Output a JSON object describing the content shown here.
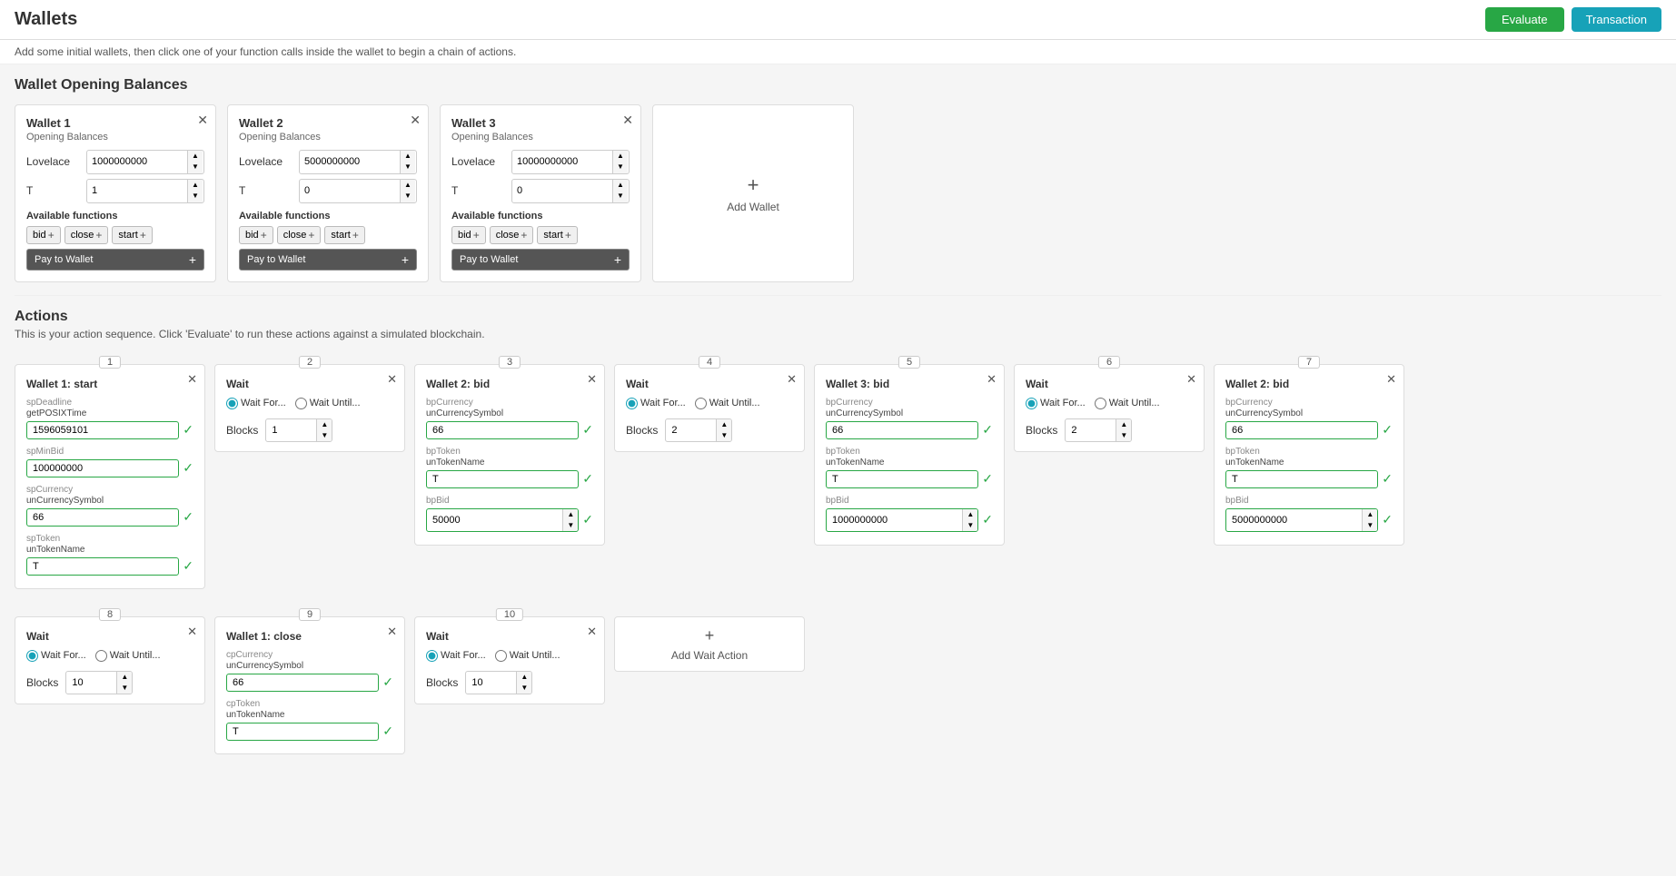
{
  "app": {
    "title": "Wallets",
    "subtitle": "Add some initial wallets, then click one of your function calls inside the wallet to begin a chain of actions.",
    "evaluate_label": "Evaluate",
    "transaction_label": "Transaction"
  },
  "wallets_section": {
    "title": "Wallet Opening Balances",
    "wallets": [
      {
        "id": 1,
        "title": "Wallet 1",
        "opening_balances_label": "Opening Balances",
        "lovelace_label": "Lovelace",
        "lovelace_value": "1000000000",
        "t_label": "T",
        "t_value": "1",
        "available_functions_label": "Available functions",
        "functions": [
          "bid",
          "close",
          "start"
        ],
        "pay_to_wallet_label": "Pay to Wallet"
      },
      {
        "id": 2,
        "title": "Wallet 2",
        "opening_balances_label": "Opening Balances",
        "lovelace_label": "Lovelace",
        "lovelace_value": "5000000000",
        "t_label": "T",
        "t_value": "0",
        "available_functions_label": "Available functions",
        "functions": [
          "bid",
          "close",
          "start"
        ],
        "pay_to_wallet_label": "Pay to Wallet"
      },
      {
        "id": 3,
        "title": "Wallet 3",
        "opening_balances_label": "Opening Balances",
        "lovelace_label": "Lovelace",
        "lovelace_value": "10000000000",
        "t_label": "T",
        "t_value": "0",
        "available_functions_label": "Available functions",
        "functions": [
          "bid",
          "close",
          "start"
        ],
        "pay_to_wallet_label": "Pay to Wallet"
      }
    ],
    "add_wallet_label": "Add Wallet"
  },
  "actions_section": {
    "title": "Actions",
    "subtitle": "This is your action sequence. Click 'Evaluate' to run these actions against a simulated blockchain.",
    "add_wait_label": "Add Wait Action",
    "actions": [
      {
        "num": "1",
        "type": "wallet_start",
        "title": "Wallet 1: start",
        "fields": [
          {
            "label": "spDeadline",
            "sublabel": "getPOSIXTime",
            "value": "1596059101",
            "valid": true
          },
          {
            "label": "spMinBid",
            "sublabel": "",
            "value": "100000000",
            "valid": true
          },
          {
            "label": "spCurrency",
            "sublabel": "unCurrencySymbol",
            "value": "66",
            "valid": true
          },
          {
            "label": "spToken",
            "sublabel": "unTokenName",
            "value": "T",
            "valid": true
          }
        ]
      },
      {
        "num": "2",
        "type": "wait",
        "title": "Wait",
        "wait_for_checked": true,
        "wait_until_checked": false,
        "wait_for_label": "Wait For...",
        "wait_until_label": "Wait Until...",
        "blocks_label": "Blocks",
        "blocks_value": "1"
      },
      {
        "num": "3",
        "type": "wallet_bid",
        "title": "Wallet 2: bid",
        "fields": [
          {
            "label": "bpCurrency",
            "sublabel": "unCurrencySymbol",
            "value": "66",
            "valid": true
          },
          {
            "label": "bpToken",
            "sublabel": "unTokenName",
            "value": "T",
            "valid": true
          },
          {
            "label": "bpBid",
            "sublabel": "",
            "value": "50000",
            "valid": true,
            "spinner": true
          }
        ]
      },
      {
        "num": "4",
        "type": "wait",
        "title": "Wait",
        "wait_for_checked": true,
        "wait_until_checked": false,
        "wait_for_label": "Wait For...",
        "wait_until_label": "Wait Until...",
        "blocks_label": "Blocks",
        "blocks_value": "2"
      },
      {
        "num": "5",
        "type": "wallet_bid",
        "title": "Wallet 3: bid",
        "fields": [
          {
            "label": "bpCurrency",
            "sublabel": "unCurrencySymbol",
            "value": "66",
            "valid": true
          },
          {
            "label": "bpToken",
            "sublabel": "unTokenName",
            "value": "T",
            "valid": true
          },
          {
            "label": "bpBid",
            "sublabel": "",
            "value": "1000000000",
            "valid": true,
            "spinner": true
          }
        ]
      },
      {
        "num": "6",
        "type": "wait",
        "title": "Wait",
        "wait_for_checked": true,
        "wait_until_checked": false,
        "wait_for_label": "Wait For...",
        "wait_until_label": "Wait Until...",
        "blocks_label": "Blocks",
        "blocks_value": "2"
      },
      {
        "num": "7",
        "type": "wallet_bid",
        "title": "Wallet 2: bid",
        "fields": [
          {
            "label": "bpCurrency",
            "sublabel": "unCurrencySymbol",
            "value": "66",
            "valid": true
          },
          {
            "label": "bpToken",
            "sublabel": "unTokenName",
            "value": "T",
            "valid": true
          },
          {
            "label": "bpBid",
            "sublabel": "",
            "value": "5000000000",
            "valid": true,
            "spinner": true
          }
        ]
      },
      {
        "num": "8",
        "type": "wait",
        "title": "Wait",
        "wait_for_checked": true,
        "wait_until_checked": false,
        "wait_for_label": "Wait For...",
        "wait_until_label": "Wait Until...",
        "blocks_label": "Blocks",
        "blocks_value": "10"
      },
      {
        "num": "9",
        "type": "wallet_close",
        "title": "Wallet 1: close",
        "fields": [
          {
            "label": "cpCurrency",
            "sublabel": "unCurrencySymbol",
            "value": "66",
            "valid": true
          },
          {
            "label": "cpToken",
            "sublabel": "unTokenName",
            "value": "T",
            "valid": true
          }
        ]
      },
      {
        "num": "10",
        "type": "wait",
        "title": "Wait",
        "wait_for_checked": true,
        "wait_until_checked": false,
        "wait_for_label": "Wait For...",
        "wait_until_label": "Wait Until...",
        "blocks_label": "Blocks",
        "blocks_value": "10"
      }
    ]
  }
}
